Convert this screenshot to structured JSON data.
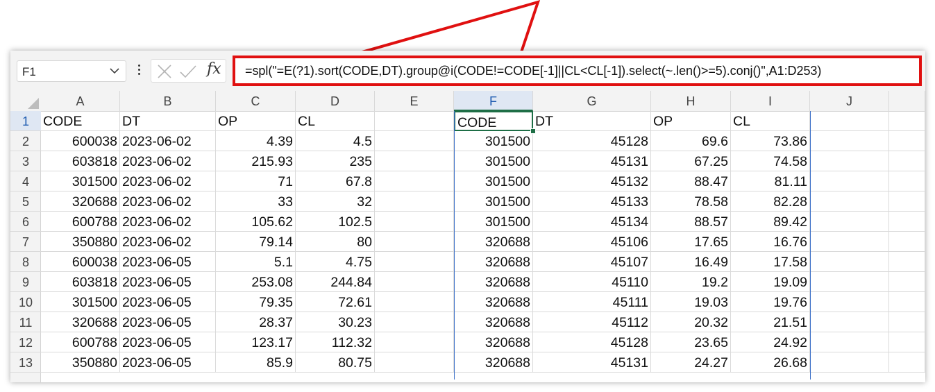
{
  "formula_bar": {
    "name_box": "F1",
    "fx_label": "fx",
    "formula": "=spl(\"=E(?1).sort(CODE,DT).group@i(CODE!=CODE[-1]||CL<CL[-1]).select(~.len()>=5).conj()\",A1:D253)"
  },
  "columns": [
    "A",
    "B",
    "C",
    "D",
    "E",
    "F",
    "G",
    "H",
    "I",
    "J"
  ],
  "rows": [
    "1",
    "2",
    "3",
    "4",
    "5",
    "6",
    "7",
    "8",
    "9",
    "10",
    "11",
    "12",
    "13"
  ],
  "source_table": {
    "headers": [
      "CODE",
      "DT",
      "OP",
      "CL"
    ],
    "rows": [
      [
        "600038",
        "2023-06-02",
        "4.39",
        "4.5"
      ],
      [
        "603818",
        "2023-06-02",
        "215.93",
        "235"
      ],
      [
        "301500",
        "2023-06-02",
        "71",
        "67.8"
      ],
      [
        "320688",
        "2023-06-02",
        "33",
        "32"
      ],
      [
        "600788",
        "2023-06-02",
        "105.62",
        "102.5"
      ],
      [
        "350880",
        "2023-06-02",
        "79.14",
        "80"
      ],
      [
        "600038",
        "2023-06-05",
        "5.1",
        "4.75"
      ],
      [
        "603818",
        "2023-06-05",
        "253.08",
        "244.84"
      ],
      [
        "301500",
        "2023-06-05",
        "79.35",
        "72.61"
      ],
      [
        "320688",
        "2023-06-05",
        "28.37",
        "30.23"
      ],
      [
        "600788",
        "2023-06-05",
        "123.17",
        "112.32"
      ],
      [
        "350880",
        "2023-06-05",
        "85.9",
        "80.75"
      ]
    ]
  },
  "result_table": {
    "headers": [
      "CODE",
      "DT",
      "OP",
      "CL"
    ],
    "rows": [
      [
        "301500",
        "45128",
        "69.6",
        "73.86"
      ],
      [
        "301500",
        "45131",
        "67.25",
        "74.58"
      ],
      [
        "301500",
        "45132",
        "88.47",
        "81.11"
      ],
      [
        "301500",
        "45133",
        "78.58",
        "82.28"
      ],
      [
        "301500",
        "45134",
        "88.57",
        "89.42"
      ],
      [
        "320688",
        "45106",
        "17.65",
        "16.76"
      ],
      [
        "320688",
        "45107",
        "16.49",
        "17.58"
      ],
      [
        "320688",
        "45110",
        "19.2",
        "19.09"
      ],
      [
        "320688",
        "45111",
        "19.03",
        "19.76"
      ],
      [
        "320688",
        "45112",
        "20.32",
        "21.51"
      ],
      [
        "320688",
        "45128",
        "23.65",
        "24.92"
      ],
      [
        "320688",
        "45131",
        "24.27",
        "26.68"
      ]
    ]
  },
  "colors": {
    "highlight": "#e01010",
    "selection": "#1e6e46",
    "active_header": "#dfe7f3"
  }
}
